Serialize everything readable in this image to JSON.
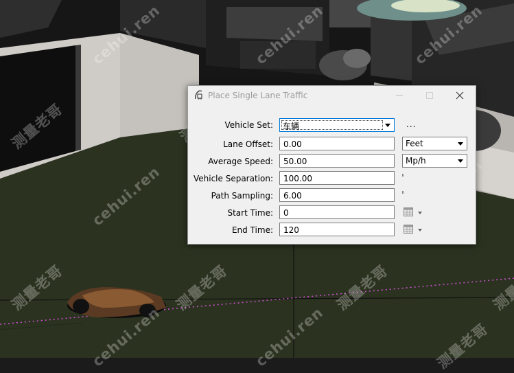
{
  "dialog": {
    "title": "Place Single Lane Traffic",
    "icon": "traffic-lane-icon"
  },
  "form": {
    "vehicle_set": {
      "label": "Vehicle Set:",
      "value": "车辆",
      "more_label": "..."
    },
    "lane_offset": {
      "label": "Lane Offset:",
      "value": "0.00",
      "unit": "Feet"
    },
    "average_speed": {
      "label": "Average Speed:",
      "value": "50.00",
      "unit": "Mp/h"
    },
    "vehicle_separation": {
      "label": "Vehicle Separation:",
      "value": "100.00"
    },
    "path_sampling": {
      "label": "Path Sampling:",
      "value": "6.00"
    },
    "start_time": {
      "label": "Start Time:",
      "value": "0"
    },
    "end_time": {
      "label": "End Time:",
      "value": "120"
    }
  },
  "watermarks": [
    "cehui.ren",
    "测量老哥",
    "cehui.ren",
    "测量老哥",
    "cehui.ren",
    "测量老哥",
    "cehui.ren",
    "测量老哥",
    "cehui.ren",
    "测量老哥",
    "cehui.ren",
    "测量老哥",
    "cehui.ren",
    "测量老哥",
    "cehui.ren",
    "测量老哥"
  ],
  "colors": {
    "ground": "#2b3320",
    "wall": "#cfcbc6",
    "selection_border": "#0078d7",
    "path_dots": "#d24fd8"
  }
}
